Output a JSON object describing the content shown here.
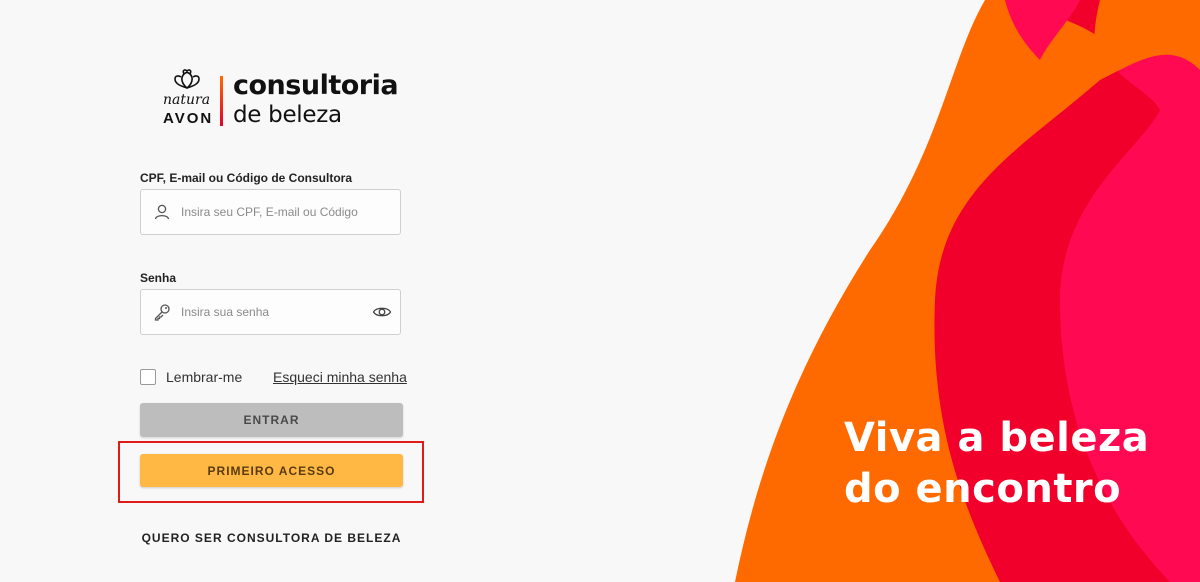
{
  "brand": {
    "natura": "natura",
    "avon": "AVON",
    "title_line1": "consultoria",
    "title_line2": "de beleza"
  },
  "form": {
    "login_label": "CPF, E-mail ou Código de Consultora",
    "login_placeholder": "Insira seu CPF, E-mail ou Código",
    "password_label": "Senha",
    "password_placeholder": "Insira sua senha",
    "remember_label": "Lembrar-me",
    "forgot_link": "Esqueci minha senha",
    "enter_button": "ENTRAR",
    "first_access_button": "PRIMEIRO ACESSO",
    "become_consultant_link": "QUERO SER CONSULTORA DE BELEZA"
  },
  "hero": {
    "tagline_line1": "Viva a beleza",
    "tagline_line2": "do encontro"
  },
  "colors": {
    "accent_orange": "#ff6a00",
    "accent_red": "#f0002a",
    "accent_pink": "#ff0a52",
    "first_access_button": "#ffb844",
    "enter_button_disabled": "#bdbdbd",
    "highlight": "#e11a1a"
  },
  "icons": {
    "login_field": "user-icon",
    "password_field": "key-icon",
    "password_toggle": "eye-icon"
  }
}
